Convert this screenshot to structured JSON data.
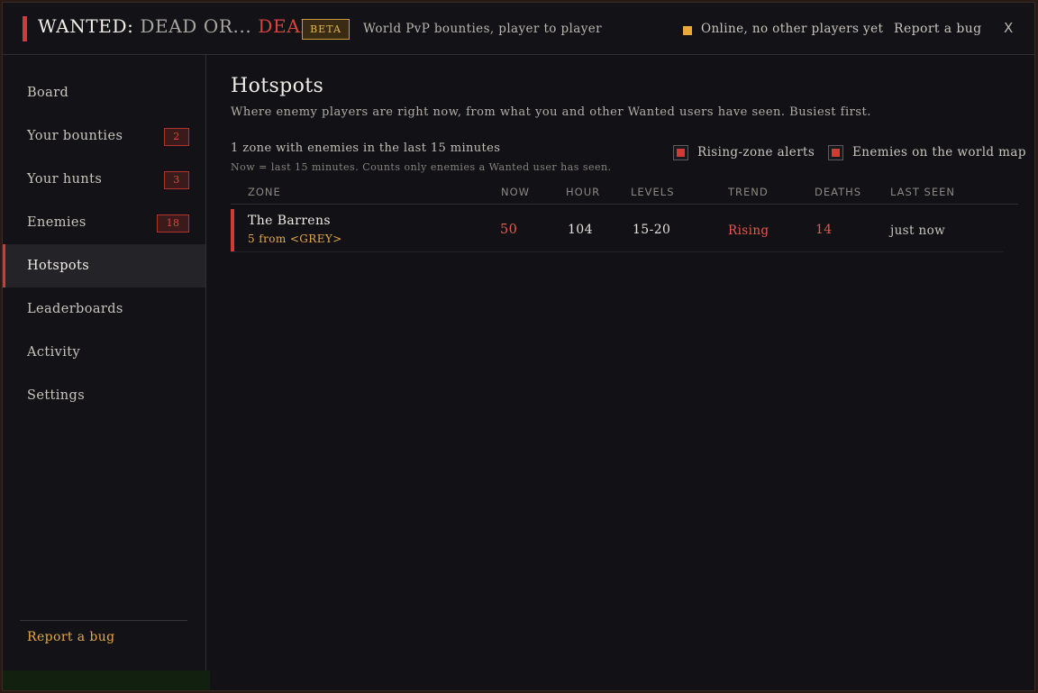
{
  "header": {
    "title_part1": "WANTED:",
    "title_part2": "DEAD OR...",
    "title_part3": "DEAD",
    "beta_label": "BETA",
    "tagline": "World PvP bounties, player to player",
    "status_text": "Online, no other players yet",
    "status_color": "#e8a93a",
    "report_bug": "Report a bug",
    "close_label": "X"
  },
  "sidebar": {
    "items": [
      {
        "label": "Board"
      },
      {
        "label": "Your bounties",
        "badge": "2"
      },
      {
        "label": "Your hunts",
        "badge": "3"
      },
      {
        "label": "Enemies",
        "badge": "18"
      },
      {
        "label": "Hotspots",
        "active": true
      },
      {
        "label": "Leaderboards"
      },
      {
        "label": "Activity"
      },
      {
        "label": "Settings"
      }
    ],
    "report_bug": "Report a bug"
  },
  "main": {
    "title": "Hotspots",
    "subtitle": "Where enemy players are right now, from what you and other Wanted users have seen. Busiest first.",
    "zone_count": "1 zone with enemies in the last 15 minutes",
    "zone_note": "Now = last 15 minutes. Counts only enemies a Wanted user has seen.",
    "toggles": {
      "rising_alerts": {
        "label": "Rising-zone alerts",
        "checked": true
      },
      "world_map": {
        "label": "Enemies on the world map",
        "checked": true
      }
    },
    "table": {
      "columns": [
        "ZONE",
        "NOW",
        "HOUR",
        "LEVELS",
        "TREND",
        "DEATHS",
        "LAST SEEN"
      ],
      "rows": [
        {
          "zone": "The Barrens",
          "zone_sub": "5 from <GREY>",
          "now": "50",
          "hour": "104",
          "levels": "15-20",
          "trend": "Rising",
          "deaths": "14",
          "last_seen": "just now"
        }
      ]
    }
  },
  "colors": {
    "accent": "#d23a34",
    "gold": "#e6a848",
    "background": "#121216"
  }
}
